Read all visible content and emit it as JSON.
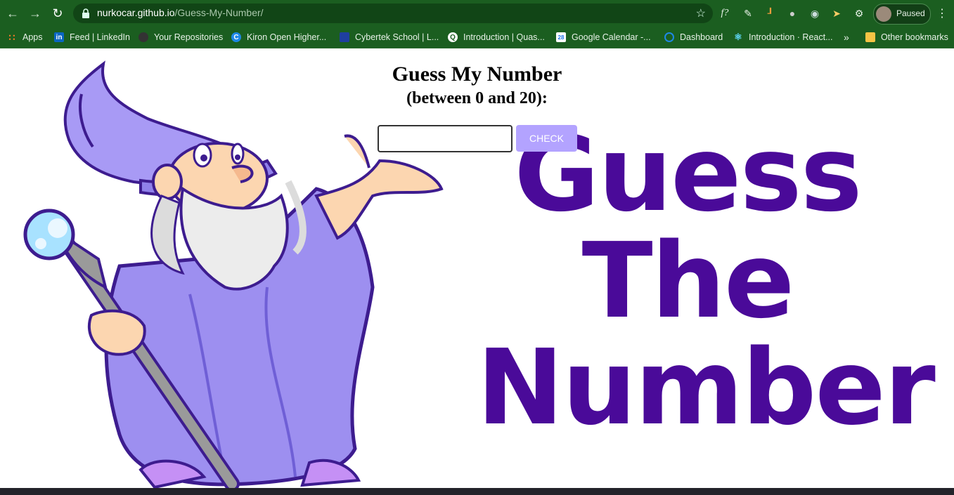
{
  "browser": {
    "url_host": "nurkocar.github.io",
    "url_path": "/Guess-My-Number/",
    "profile_label": "Paused",
    "bookmarks": [
      {
        "label": "Apps"
      },
      {
        "label": "Feed | LinkedIn"
      },
      {
        "label": "Your Repositories"
      },
      {
        "label": "Kiron Open Higher..."
      },
      {
        "label": "Cybertek School | L..."
      },
      {
        "label": "Introduction | Quas..."
      },
      {
        "label": "Google Calendar -..."
      },
      {
        "label": "Dashboard"
      },
      {
        "label": "Introduction · React..."
      }
    ],
    "overflow_label": "»",
    "other_bookmarks": "Other bookmarks"
  },
  "game": {
    "title": "Guess My Number",
    "subtitle": "(between 0 and 20):",
    "input_value": "",
    "check_label": "CHECK",
    "hero_lines": [
      "Guess",
      "The",
      "Number"
    ]
  },
  "colors": {
    "chrome": "#1b5e20",
    "check_button": "#b3a3ff",
    "hero_text": "#4a0a99",
    "wizard_robe": "#9d8ff0"
  }
}
